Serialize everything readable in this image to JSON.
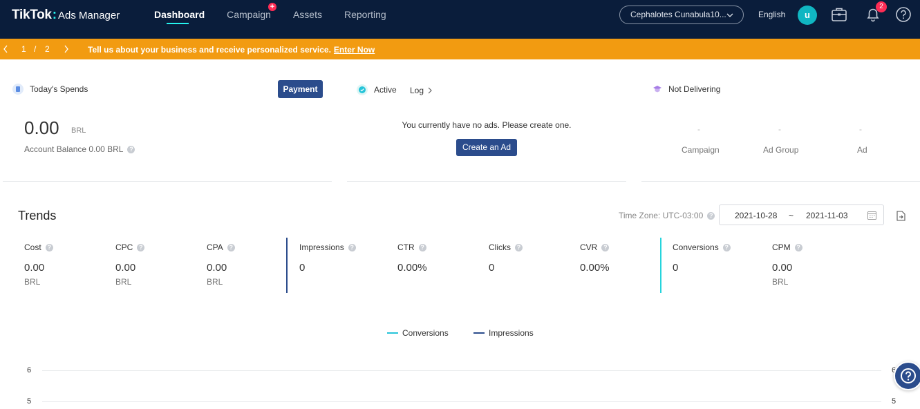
{
  "header": {
    "logo_main": "TikTok",
    "logo_colon": ":",
    "logo_sub": "Ads Manager",
    "nav": [
      {
        "label": "Dashboard"
      },
      {
        "label": "Campaign"
      },
      {
        "label": "Assets"
      },
      {
        "label": "Reporting"
      }
    ],
    "campaign_badge": "+",
    "account": "Cephalotes Cunabula10...",
    "language": "English",
    "avatar_letter": "u",
    "notification_count": "2",
    "icons": [
      "briefcase-icon",
      "bell-icon",
      "help-icon"
    ]
  },
  "banner": {
    "page_current": "1",
    "page_sep": "/",
    "page_total": "2",
    "message": "Tell us about your business and receive personalized service.",
    "link": "Enter Now"
  },
  "spends": {
    "title": "Today's Spends",
    "payment_label": "Payment",
    "amount": "0.00",
    "currency": "BRL",
    "balance": "Account Balance 0.00 BRL"
  },
  "active": {
    "title": "Active",
    "log_label": "Log",
    "empty_message": "You currently have no ads. Please create one.",
    "create_label": "Create an Ad"
  },
  "not_delivering": {
    "title": "Not Delivering",
    "cols": [
      {
        "value": "-",
        "label": "Campaign"
      },
      {
        "value": "-",
        "label": "Ad Group"
      },
      {
        "value": "-",
        "label": "Ad"
      }
    ]
  },
  "trends": {
    "title": "Trends",
    "timezone": "Time Zone: UTC-03:00",
    "date_start": "2021-10-28",
    "date_sep": "~",
    "date_end": "2021-11-03",
    "metrics": [
      {
        "label": "Cost",
        "value": "0.00",
        "unit": "BRL"
      },
      {
        "label": "CPC",
        "value": "0.00",
        "unit": "BRL"
      },
      {
        "label": "CPA",
        "value": "0.00",
        "unit": "BRL"
      },
      {
        "label": "Impressions",
        "value": "0",
        "unit": ""
      },
      {
        "label": "CTR",
        "value": "0.00%",
        "unit": ""
      },
      {
        "label": "Clicks",
        "value": "0",
        "unit": ""
      },
      {
        "label": "CVR",
        "value": "0.00%",
        "unit": ""
      },
      {
        "label": "Conversions",
        "value": "0",
        "unit": ""
      },
      {
        "label": "CPM",
        "value": "0.00",
        "unit": "BRL"
      }
    ]
  },
  "chart_data": {
    "type": "line",
    "series": [
      {
        "name": "Conversions",
        "color": "#25c4d9",
        "values": []
      },
      {
        "name": "Impressions",
        "color": "#2b4c8c",
        "values": []
      }
    ],
    "y_ticks_left": [
      "6",
      "5"
    ],
    "y_ticks_right": [
      "6",
      "5"
    ]
  }
}
